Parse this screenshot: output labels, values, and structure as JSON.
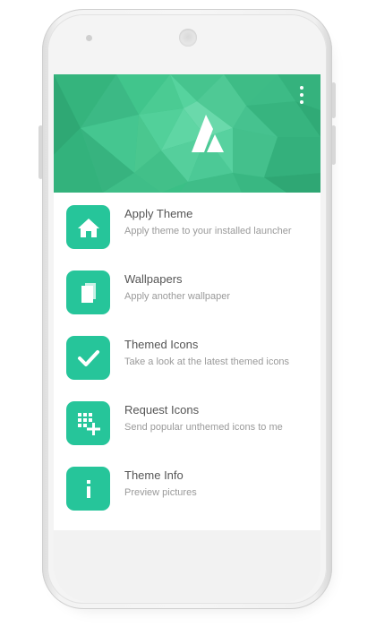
{
  "app": {
    "menu_icon": "more-vert-icon",
    "logo_icon": "triangle-a-logo-icon",
    "colors": {
      "header": "#3bbf86",
      "accent": "#26c59a",
      "title_text": "#555555",
      "subtitle_text": "#9a9a9a"
    }
  },
  "menu": {
    "items": [
      {
        "title": "Apply Theme",
        "subtitle": "Apply theme to your installed launcher",
        "icon": "home-icon"
      },
      {
        "title": "Wallpapers",
        "subtitle": "Apply another wallpaper",
        "icon": "wallpaper-icon"
      },
      {
        "title": "Themed Icons",
        "subtitle": "Take a look at the latest themed icons",
        "icon": "check-icon"
      },
      {
        "title": "Request Icons",
        "subtitle": "Send popular unthemed icons to me",
        "icon": "grid-add-icon"
      },
      {
        "title": "Theme Info",
        "subtitle": "Preview pictures",
        "icon": "info-icon"
      }
    ]
  }
}
